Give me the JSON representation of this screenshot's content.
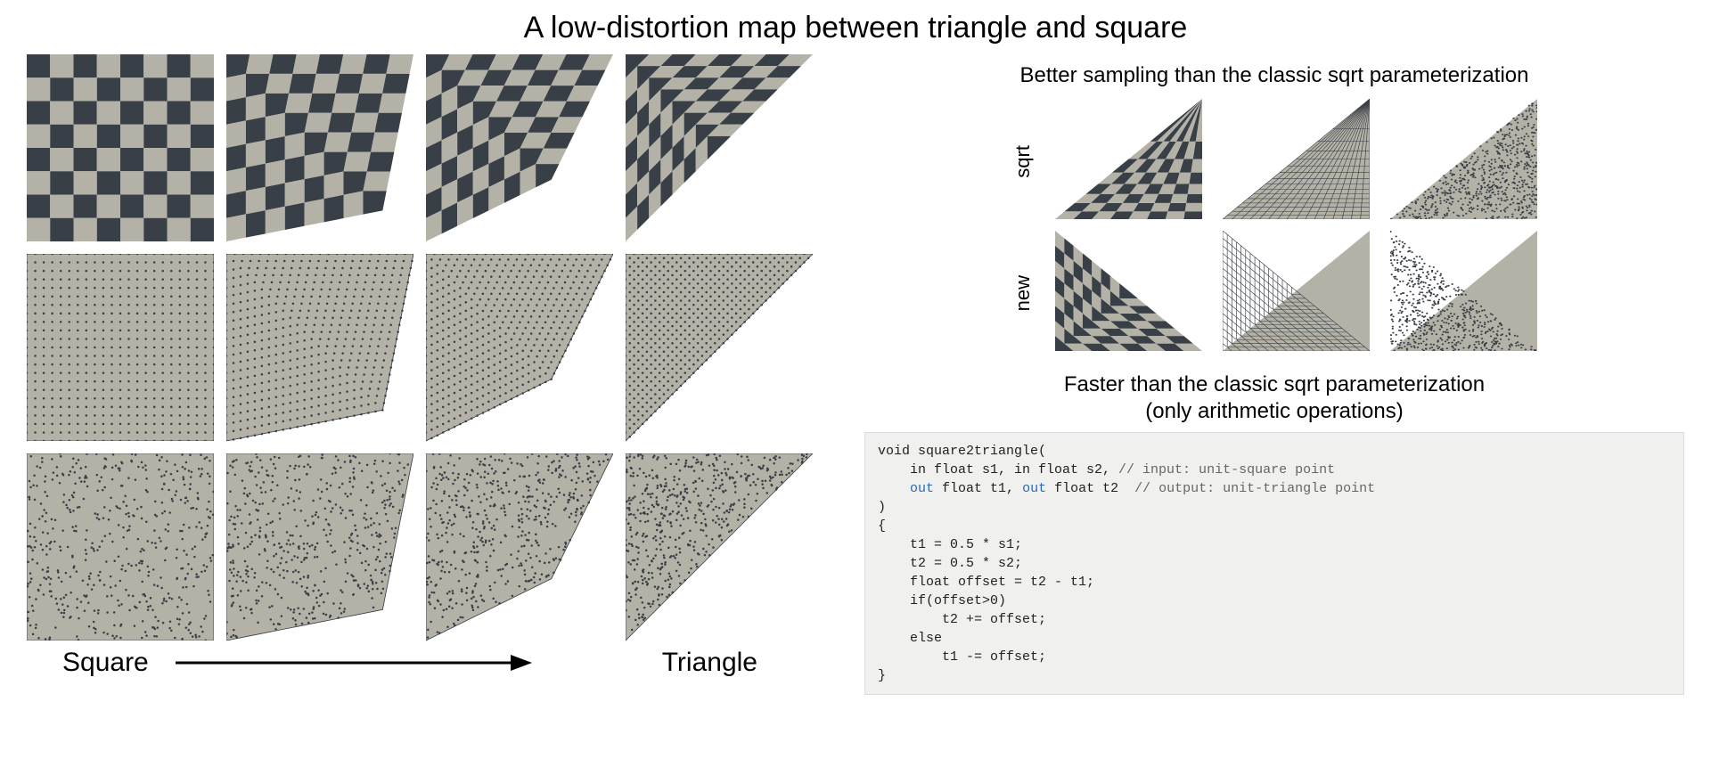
{
  "title": "A low-distortion map between triangle and square",
  "left_labels": {
    "start": "Square",
    "end": "Triangle"
  },
  "morph_steps": [
    0.0,
    0.33,
    0.66,
    1.0
  ],
  "colors": {
    "dark": "#393f46",
    "light": "#b4b2a7",
    "stroke": "#393f46"
  },
  "right_headers": {
    "sampling": "Better sampling than the classic sqrt parameterization",
    "faster_line1": "Faster than the classic sqrt parameterization",
    "faster_line2": "(only arithmetic operations)"
  },
  "compare_row_labels": {
    "sqrt": "sqrt",
    "new": "new"
  },
  "code": {
    "line0": "void square2triangle(",
    "line1_a": "    in float s1, in float s2, ",
    "line1_b": "// input: unit-square point",
    "line2_a": "    ",
    "line2_out": "out",
    "line2_b": " float t1, ",
    "line2_out2": "out",
    "line2_c": " float t2  ",
    "line2_d": "// output: unit-triangle point",
    "line3": ")",
    "line4": "{",
    "line5": "    t1 = 0.5 * s1;",
    "line6": "    t2 = 0.5 * s2;",
    "line7": "    float offset = t2 - t1;",
    "line8": "    if(offset>0)",
    "line9": "        t2 += offset;",
    "line10": "    else",
    "line11": "        t1 -= offset;",
    "line12": "}"
  }
}
